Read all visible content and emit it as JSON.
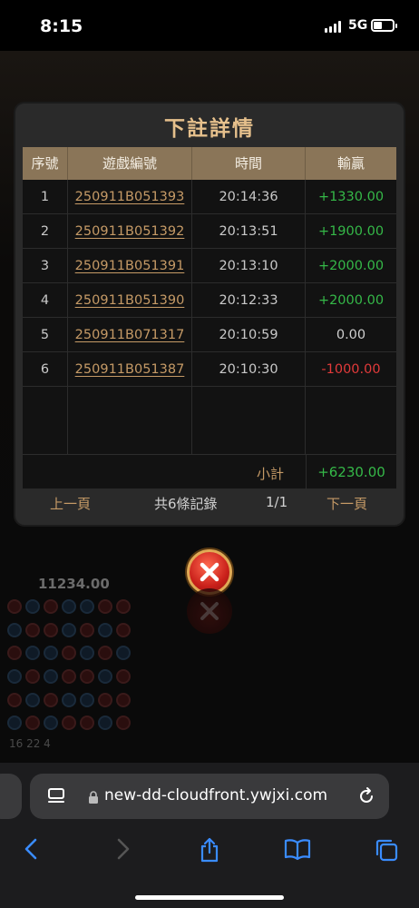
{
  "status_bar": {
    "time": "8:15",
    "network": "5G"
  },
  "background": {
    "balance_amount": "11234.00",
    "bead_counts": "16  22  4"
  },
  "modal": {
    "title": "下註詳情",
    "columns": [
      "序號",
      "遊戲編號",
      "時間",
      "輸贏"
    ],
    "rows": [
      {
        "no": "1",
        "game_id": "250911B051393",
        "time": "20:14:36",
        "result": "+1330.00",
        "result_type": "pos"
      },
      {
        "no": "2",
        "game_id": "250911B051392",
        "time": "20:13:51",
        "result": "+1900.00",
        "result_type": "pos"
      },
      {
        "no": "3",
        "game_id": "250911B051391",
        "time": "20:13:10",
        "result": "+2000.00",
        "result_type": "pos"
      },
      {
        "no": "4",
        "game_id": "250911B051390",
        "time": "20:12:33",
        "result": "+2000.00",
        "result_type": "pos"
      },
      {
        "no": "5",
        "game_id": "250911B071317",
        "time": "20:10:59",
        "result": "0.00",
        "result_type": "zero"
      },
      {
        "no": "6",
        "game_id": "250911B051387",
        "time": "20:10:30",
        "result": "-1000.00",
        "result_type": "neg"
      }
    ],
    "subtotal_label": "小計",
    "subtotal_value": "+6230.00",
    "pager": {
      "prev": "上一頁",
      "total": "共6條記錄",
      "page": "1/1",
      "next": "下一頁"
    }
  },
  "close_button": {
    "icon": "close-icon"
  },
  "browser": {
    "url": "new-dd-cloudfront.ywjxi.com"
  },
  "colors": {
    "accent_gold": "#c59a66",
    "header_bg": "#8a7558",
    "win_green": "#35b848",
    "loss_red": "#e23a3a"
  }
}
